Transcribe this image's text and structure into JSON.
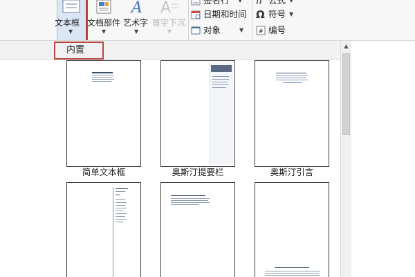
{
  "ribbon": {
    "textbox_label": "文本框",
    "doc_parts_label": "文档部件",
    "wordart_label": "艺术字",
    "dropcap_label": "首字下沉",
    "signature_line_label": "签名行",
    "datetime_label": "日期和时间",
    "object_label": "对象",
    "equation_label": "公式",
    "symbol_label": "符号",
    "number_label": "编号"
  },
  "gallery": {
    "section_title": "内置",
    "items": [
      {
        "label": "简单文本框"
      },
      {
        "label": "奥斯汀提要栏"
      },
      {
        "label": "奥斯汀引言"
      },
      {
        "label": ""
      },
      {
        "label": ""
      },
      {
        "label": ""
      }
    ]
  },
  "colors": {
    "highlight_red": "#b84642",
    "accent_blue": "#3b4d6c",
    "selected_bg": "#dbe6f4"
  }
}
